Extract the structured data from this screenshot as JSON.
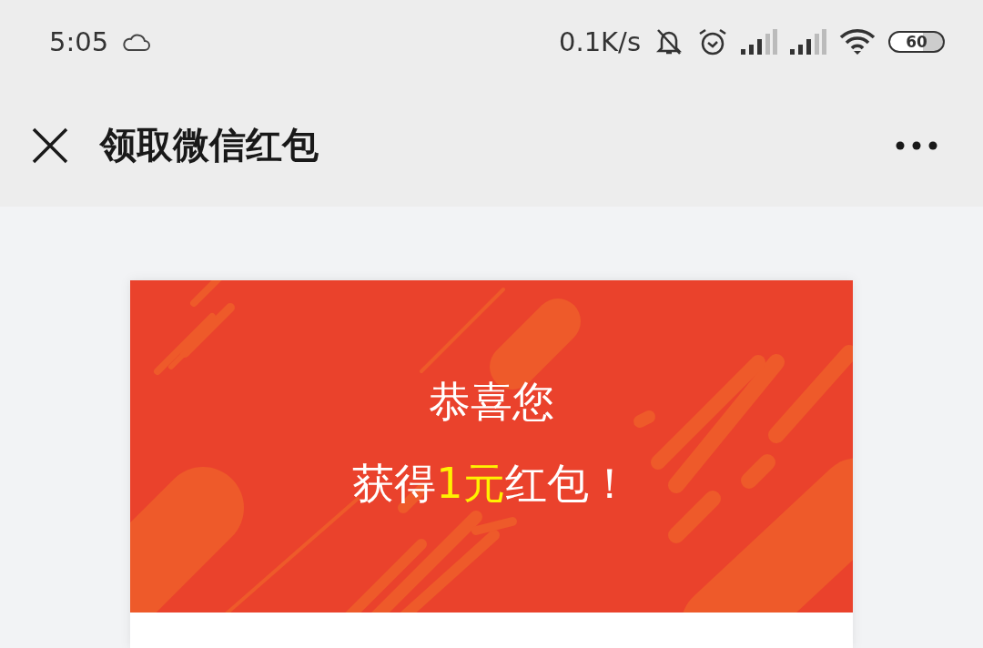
{
  "status_bar": {
    "time": "5:05",
    "network_speed": "0.1K/s",
    "battery": "60"
  },
  "nav_bar": {
    "title": "领取微信红包"
  },
  "card": {
    "heading": "恭喜您",
    "prize": {
      "before": "获得",
      "amount": "1元",
      "after": "红包！"
    }
  }
}
